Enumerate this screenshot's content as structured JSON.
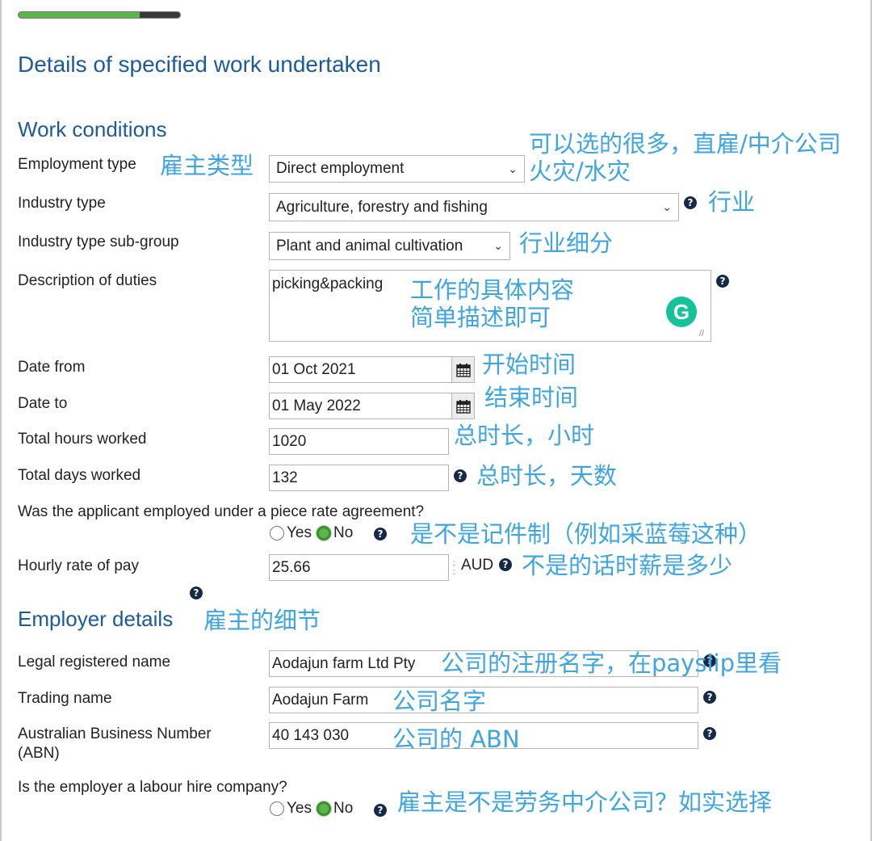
{
  "progress": {
    "percent": 75,
    "fill_color": "#5cb54a",
    "track_color": "#3a3a3a"
  },
  "page_title": "Details of specified work undertaken",
  "work_conditions": {
    "heading": "Work conditions",
    "employment_type": {
      "label": "Employment type",
      "value": "Direct employment",
      "annotation": "雇主类型"
    },
    "employment_note": {
      "line1": "可以选的很多，直雇/中介公司",
      "line2": "火灾/水灾"
    },
    "industry_type": {
      "label": "Industry type",
      "value": "Agriculture, forestry and fishing",
      "annotation": "行业"
    },
    "industry_subgroup": {
      "label": "Industry type sub-group",
      "value": "Plant and animal cultivation",
      "annotation": "行业细分"
    },
    "description": {
      "label": "Description of duties",
      "value": "picking&packing",
      "annotation_line1": "工作的具体内容",
      "annotation_line2": "简单描述即可"
    },
    "date_from": {
      "label": "Date from",
      "value": "01 Oct 2021",
      "annotation": "开始时间"
    },
    "date_to": {
      "label": "Date to",
      "value": "01 May 2022",
      "annotation": "结束时间"
    },
    "total_hours": {
      "label": "Total hours worked",
      "value": "1020",
      "annotation": "总时长，小时"
    },
    "total_days": {
      "label": "Total days worked",
      "value": "132",
      "annotation": "总时长，天数"
    },
    "piece_rate": {
      "question": "Was the applicant employed under a piece rate agreement?",
      "options": [
        "Yes",
        "No"
      ],
      "selected": "No",
      "annotation": "是不是记件制（例如采蓝莓这种）"
    },
    "hourly_rate": {
      "label": "Hourly rate of pay",
      "value": "25.66",
      "currency": "AUD",
      "annotation": "不是的话时薪是多少"
    }
  },
  "employer_details": {
    "heading": "Employer details",
    "heading_annotation": "雇主的细节",
    "legal_name": {
      "label": "Legal registered name",
      "value": "Aodajun farm Ltd Pty",
      "annotation": "公司的注册名字，在payslip里看"
    },
    "trading_name": {
      "label": "Trading name",
      "value": "Aodajun Farm",
      "annotation": "公司名字"
    },
    "abn": {
      "label_line1": "Australian Business Number",
      "label_line2": "(ABN)",
      "value": "40 143 030",
      "annotation": "公司的 ABN"
    },
    "labour_hire": {
      "question": "Is the employer a labour hire company?",
      "options": [
        "Yes",
        "No"
      ],
      "selected": "No",
      "annotation": "雇主是不是劳务中介公司？如实选择"
    }
  },
  "icons": {
    "help": "?",
    "calendar": "calendar-icon",
    "chevron": "⌄",
    "grammarly": "G"
  }
}
